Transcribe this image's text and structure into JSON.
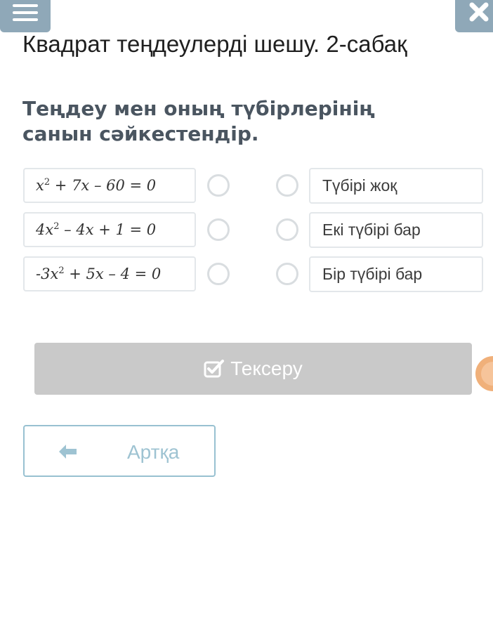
{
  "header": {
    "menu_icon": "hamburger-menu-icon",
    "close_icon": "close-icon",
    "accent_color": "#8fa8b8"
  },
  "lesson": {
    "title": "Квадрат теңдеулерді шешу. 2-сабақ"
  },
  "task": {
    "question": "Теңдеу мен оның түбірлерінің санын сәйкестендір.",
    "equations": [
      {
        "lead": "",
        "var": "x",
        "exp": "2",
        "rest": " + 7x – 60 = 0"
      },
      {
        "lead": "4",
        "var": "x",
        "exp": "2",
        "rest": " – 4x + 1 = 0"
      },
      {
        "lead": "-3",
        "var": "x",
        "exp": "2",
        "rest": " + 5x – 4 = 0"
      }
    ],
    "answers": [
      {
        "label": "Түбірі жоқ"
      },
      {
        "label": "Екі түбірі бар"
      },
      {
        "label": "Бір түбірі бар"
      }
    ]
  },
  "actions": {
    "check_label": "Тексеру",
    "check_icon": "checkbox-check-icon",
    "back_label": "Артқа",
    "back_icon": "arrow-left-icon",
    "disabled_color": "#c9c9c9"
  }
}
